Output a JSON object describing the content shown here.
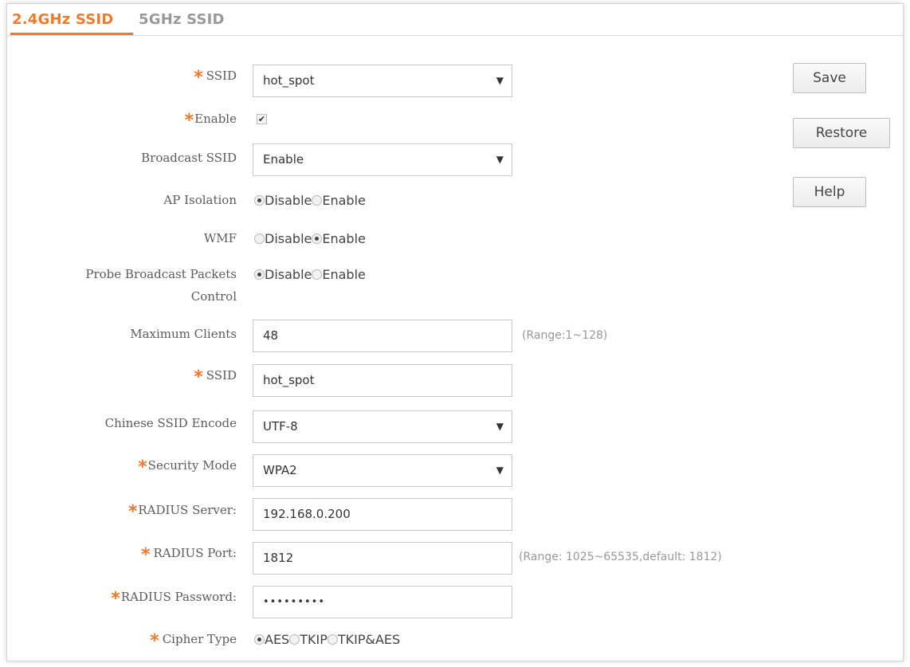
{
  "tabs": [
    {
      "label": "2.4GHz SSID",
      "active": true
    },
    {
      "label": "5GHz SSID",
      "active": false
    }
  ],
  "form": {
    "ssid_select": {
      "label": "SSID",
      "value": "hot_spot"
    },
    "enable": {
      "label": "Enable",
      "checked": true
    },
    "broadcast_ssid": {
      "label": "Broadcast SSID",
      "value": "Enable"
    },
    "ap_isolation": {
      "label": "AP Isolation",
      "options": [
        "Disable",
        "Enable"
      ],
      "selected": "Disable"
    },
    "wmf": {
      "label": "WMF",
      "options": [
        "Disable",
        "Enable"
      ],
      "selected": "Enable"
    },
    "probe": {
      "label": "Probe Broadcast Packets Control",
      "options": [
        "Disable",
        "Enable"
      ],
      "selected": "Disable"
    },
    "max_clients": {
      "label": "Maximum Clients",
      "value": "48",
      "hint": "(Range:1~128)"
    },
    "ssid_name": {
      "label": "SSID",
      "value": "hot_spot"
    },
    "chinese_encode": {
      "label": "Chinese SSID Encode",
      "value": "UTF-8"
    },
    "security_mode": {
      "label": "Security Mode",
      "value": "WPA2"
    },
    "radius_server": {
      "label": "RADIUS Server:",
      "value": "192.168.0.200"
    },
    "radius_port": {
      "label": "RADIUS Port:",
      "value": "1812",
      "hint": "(Range: 1025~65535,default: 1812)"
    },
    "radius_password": {
      "label": "RADIUS Password:",
      "value": "•••••••••"
    },
    "cipher_type": {
      "label": "Cipher Type",
      "options": [
        "AES",
        "TKIP",
        "TKIP&AES"
      ],
      "selected": "AES"
    }
  },
  "buttons": {
    "save": "Save",
    "restore": "Restore",
    "help": "Help"
  },
  "symbols": {
    "required": "*",
    "dropdown": "▼",
    "check": "✔"
  },
  "colors": {
    "accent": "#f07a2a"
  }
}
